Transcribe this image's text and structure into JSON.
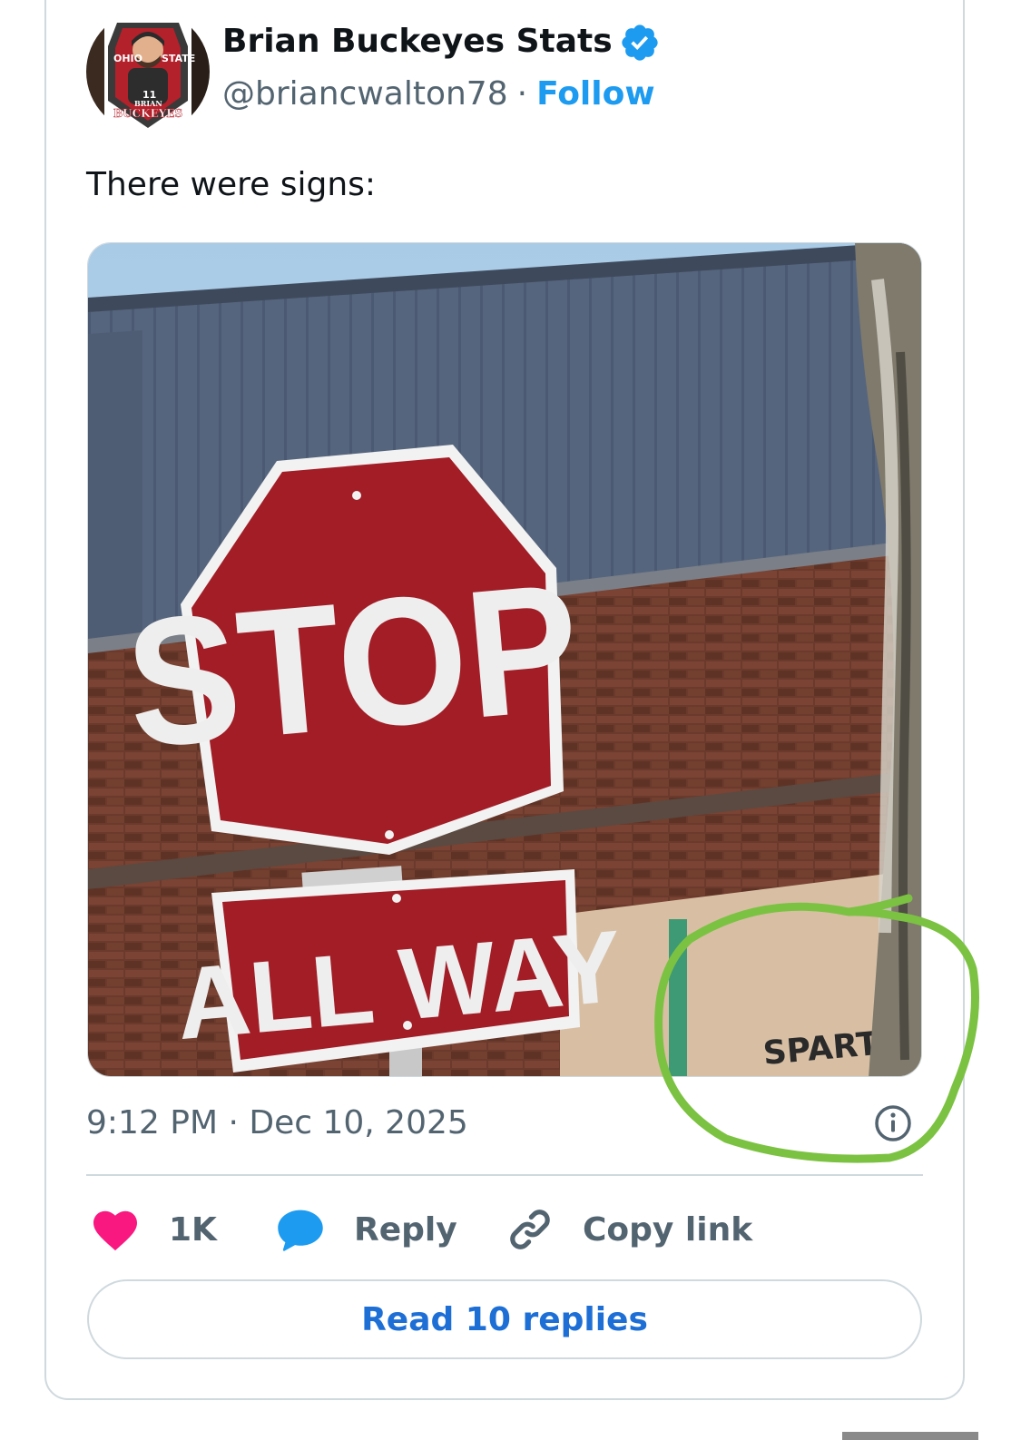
{
  "author": {
    "display_name": "Brian Buckeyes Stats",
    "handle": "@briancwalton78",
    "separator": "·",
    "follow_label": "Follow",
    "avatar_text": [
      "OHIO",
      "STATE",
      "11",
      "BRIAN",
      "BUCKEYES"
    ]
  },
  "tweet": {
    "text": "There were signs:",
    "timestamp": "9:12 PM · Dec 10, 2025"
  },
  "photo": {
    "stop_sign": "STOP",
    "plate_text": "ALL WAY",
    "wall_text": "SPART"
  },
  "actions": {
    "like_count": "1K",
    "reply_label": "Reply",
    "copy_label": "Copy link"
  },
  "read_replies_label": "Read 10 replies",
  "colors": {
    "accent": "#1d9bf0",
    "like": "#f91880",
    "annotation": "#7cc242"
  },
  "icons": [
    "verified-badge-icon",
    "info-icon",
    "heart-icon",
    "reply-bubble-icon",
    "link-icon"
  ]
}
